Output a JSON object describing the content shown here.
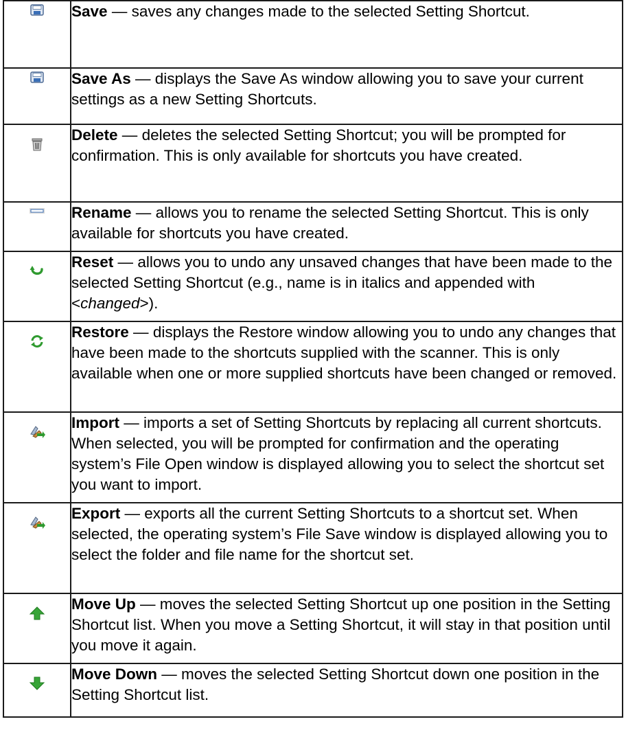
{
  "rows": [
    {
      "icon": "save-icon",
      "name": "Save",
      "sep": " — ",
      "desc": "saves any changes made to the selected Setting Shortcut."
    },
    {
      "icon": "save-as-icon",
      "name": "Save As",
      "sep": " — ",
      "desc": "displays the Save As window allowing you to save your current settings as a new Setting Shortcuts."
    },
    {
      "icon": "trash-icon",
      "name": "Delete",
      "sep": " — ",
      "desc": "deletes the selected Setting Shortcut; you will be prompted for confirmation. This is only available for shortcuts you have created."
    },
    {
      "icon": "rename-icon",
      "name": "Rename",
      "sep": " — ",
      "desc": "allows you to rename the selected Setting Shortcut. This is only available for shortcuts you have created."
    },
    {
      "icon": "undo-arrow-icon",
      "name": "Reset",
      "sep": " — ",
      "desc": "allows you to undo any unsaved changes that have been made to the selected Setting Shortcut (e.g., name is in italics and appended with <",
      "desc_em": "changed",
      "desc_end": ">)."
    },
    {
      "icon": "restore-icon",
      "name": "Restore",
      "sep": " — ",
      "desc": "displays the Restore window allowing you to undo any changes that have been made to the shortcuts supplied with the scanner. This is only available when one or more supplied shortcuts have been changed or removed."
    },
    {
      "icon": "import-icon",
      "name": "Import",
      "sep": " — ",
      "desc": "imports a set of Setting Shortcuts by replacing all current shortcuts. When selected, you will be prompted for confirmation and the operating system’s File Open window is displayed allowing you to select the shortcut set you want to import."
    },
    {
      "icon": "export-icon",
      "name": "Export",
      "sep": " — ",
      "desc": "exports all the current Setting Shortcuts to a shortcut set. When selected, the operating system’s File Save window is displayed allowing you to select the folder and file name for the shortcut set."
    },
    {
      "icon": "move-up-icon",
      "name": "Move Up",
      "sep": " — ",
      "desc": "moves the selected Setting Shortcut up one position in the Setting Shortcut list. When you move a Setting Shortcut, it will stay in that position until you move it again."
    },
    {
      "icon": "move-down-icon",
      "name": "Move Down",
      "sep": " — ",
      "desc": "moves the selected Setting Shortcut down one position in the Setting Shortcut list."
    }
  ]
}
